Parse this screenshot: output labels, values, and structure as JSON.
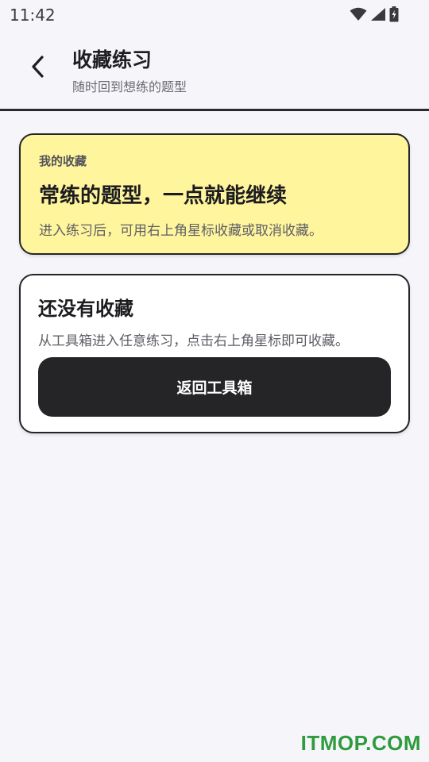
{
  "status_bar": {
    "time": "11:42",
    "icons": [
      "wifi-icon",
      "cellular-signal-icon",
      "battery-charging-icon"
    ]
  },
  "header": {
    "back_icon": "chevron-left-icon",
    "title": "收藏练习",
    "subtitle": "随时回到想练的题型"
  },
  "favorites_card": {
    "label": "我的收藏",
    "heading": "常练的题型，一点就能继续",
    "description": "进入练习后，可用右上角星标收藏或取消收藏。",
    "background_color": "#fff59d"
  },
  "empty_card": {
    "heading": "还没有收藏",
    "description": "从工具箱进入任意练习，点击右上角星标即可收藏。",
    "button_label": "返回工具箱"
  },
  "watermark": "ITMOP.COM",
  "colors": {
    "accent_dark": "#252528",
    "watermark_green": "#2e9b3e",
    "page_background": "#f6f6fa"
  }
}
